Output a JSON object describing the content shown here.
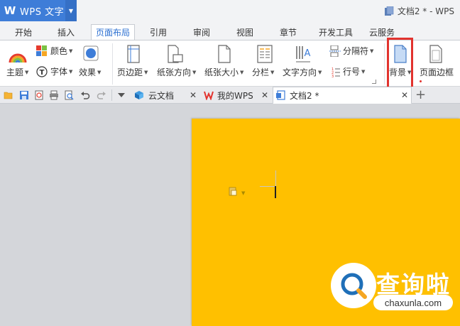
{
  "app": {
    "logo": "W",
    "name": "WPS 文字",
    "window_title": "文档2 * - WPS"
  },
  "menu_tabs": [
    "开始",
    "插入",
    "页面布局",
    "引用",
    "审阅",
    "视图",
    "章节",
    "开发工具",
    "云服务"
  ],
  "active_menu_tab": "页面布局",
  "ribbon": {
    "color": "颜色",
    "theme": "主题",
    "font": "字体",
    "effect": "效果",
    "margins": "页边距",
    "orientation": "纸张方向",
    "size": "纸张大小",
    "columns": "分栏",
    "text_direction": "文字方向",
    "separator": "分隔符",
    "line_number": "行号",
    "background": "背景",
    "page_border": "页面边框"
  },
  "doc_tabs": [
    {
      "label": "云文档",
      "icon": "cloud-doc-icon"
    },
    {
      "label": "我的WPS",
      "icon": "wps-logo-icon"
    },
    {
      "label": "文档2 *",
      "icon": "word-doc-icon"
    }
  ],
  "colors": {
    "page_background": "#ffc000",
    "app_accent": "#3e7dd8",
    "highlight": "#e2332e"
  },
  "watermark": {
    "title": "查询啦",
    "url": "chaxunla.com"
  }
}
